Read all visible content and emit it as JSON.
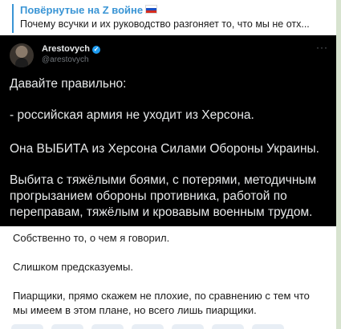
{
  "reply": {
    "title": "Повёрнутые на Z войне",
    "flag_icon": "russian-flag-icon",
    "text": "Почему всучки и их руководство разгоняет то, что мы не отх..."
  },
  "tweet": {
    "author_name": "Arestovych",
    "verified_icon": "verified-badge-icon",
    "verified_glyph": "✓",
    "handle": "@arestovych",
    "more_glyph": "···",
    "lines": [
      "Давайте правильно:",
      "- российская армия не уходит из Херсона.",
      "Она ВЫБИТА из Херсона Силами Обороны Украины.",
      "Выбита с тяжёлыми боями, с потерями, методичным",
      "прогрызанием обороны противника, работой по",
      "переправам, тяжёлым и кровавым военным трудом."
    ]
  },
  "body": {
    "lines": [
      "Собственно то, о чем я говорил.",
      "Слишком предсказуемы.",
      "Пиарщики, прямо скажем не плохие, по сравнению с тем что",
      "мы имеем в этом плане, но всего лишь пиарщики."
    ]
  },
  "colors": {
    "accent": "#3a95d5",
    "tweet_bg": "#000000",
    "chat_bg": "#d7e3cf"
  }
}
